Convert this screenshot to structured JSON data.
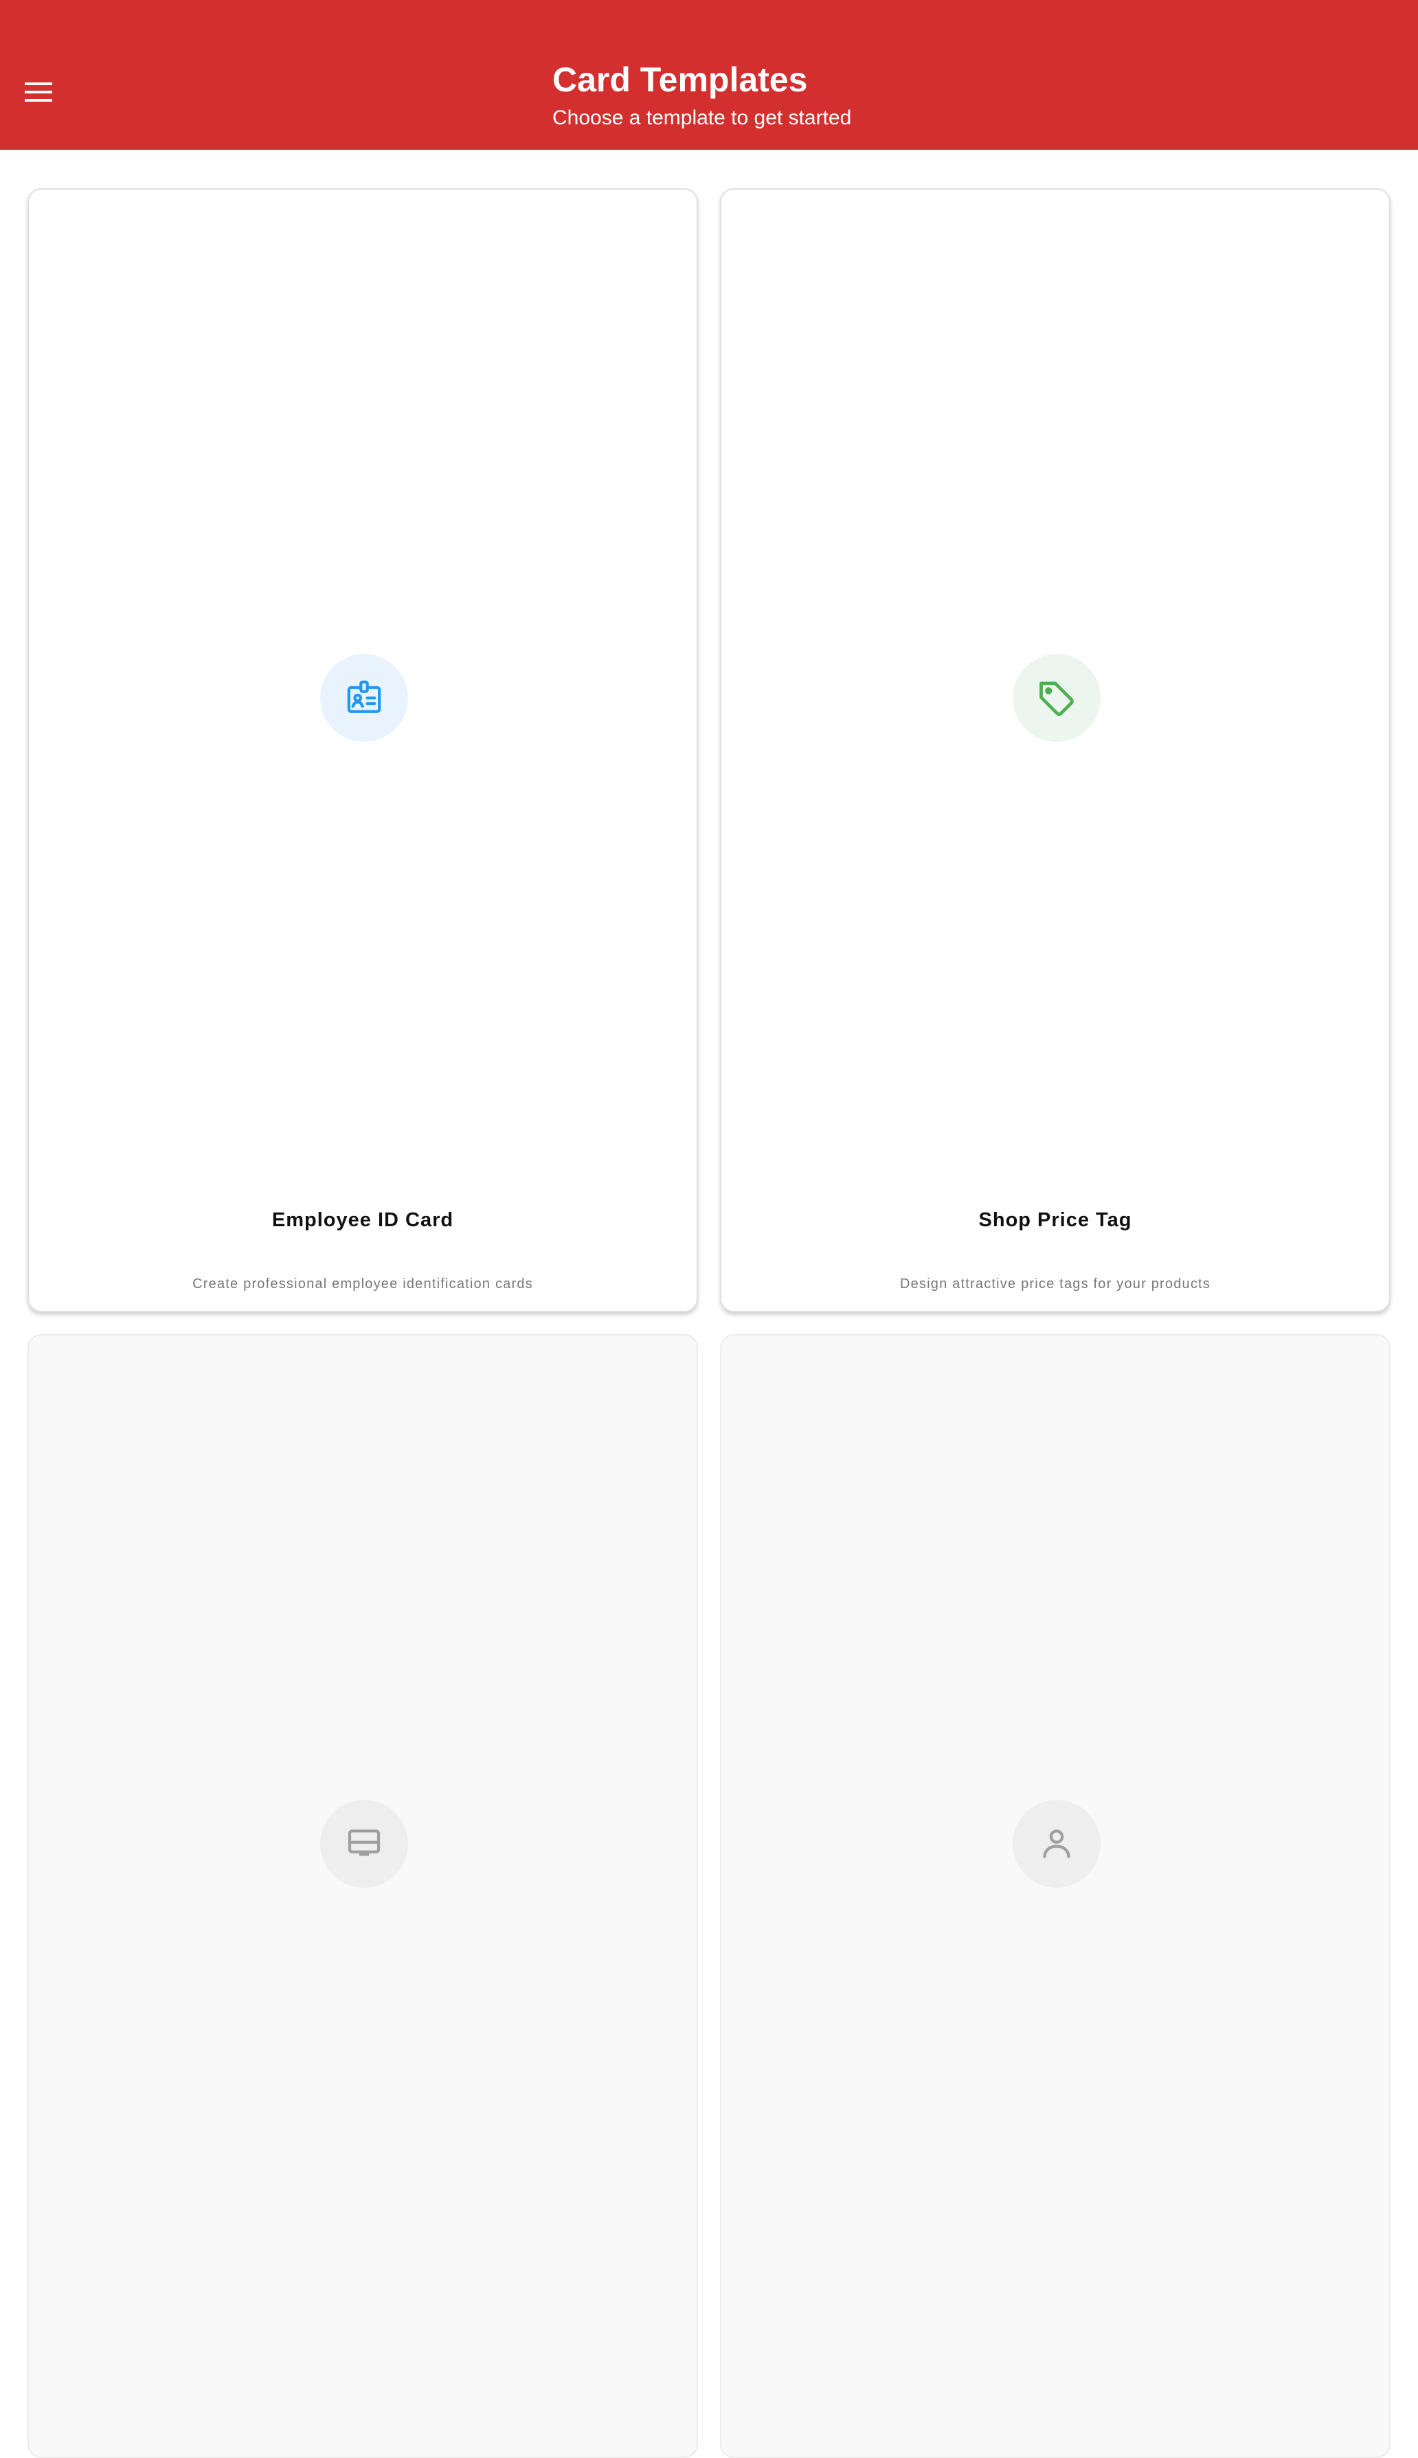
{
  "header": {
    "title": "Card Templates",
    "subtitle": "Choose a template to get started",
    "menu_icon": "menu-icon",
    "background_color": "#D32F2F"
  },
  "templates": [
    {
      "title": "Employee ID Card",
      "description": "Create professional employee identification cards",
      "icon": "badge-icon",
      "icon_color": "#2196F3",
      "icon_bg": "#E9F3FD",
      "enabled": true
    },
    {
      "title": "Shop Price Tag",
      "description": "Design attractive price tags for your products",
      "icon": "price-tag-icon",
      "icon_color": "#4CAF50",
      "icon_bg": "#EDF6EE",
      "enabled": true
    },
    {
      "icon": "credit-card-icon",
      "icon_color": "#9E9E9E",
      "icon_bg": "#EEEEEE",
      "enabled": false
    },
    {
      "icon": "person-icon",
      "icon_color": "#9E9E9E",
      "icon_bg": "#EEEEEE",
      "enabled": false
    }
  ]
}
